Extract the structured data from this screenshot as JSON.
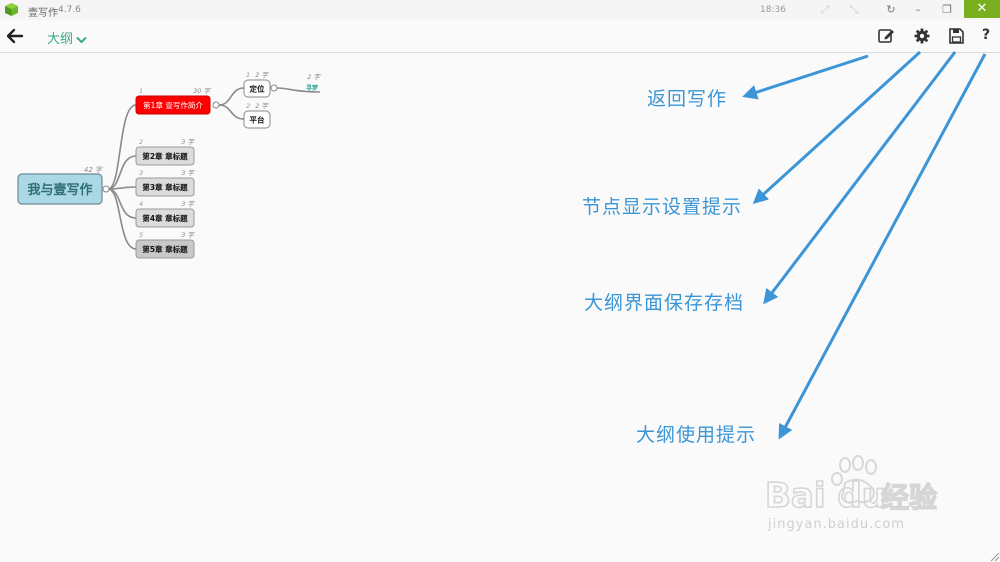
{
  "window": {
    "app_title": "壹写作",
    "version": "4.7.6",
    "clock": "18:36",
    "accent_color": "#7ab01f"
  },
  "toolbar": {
    "view_label": "大纲",
    "tools": [
      "edit-icon",
      "gear-icon",
      "save-icon",
      "help-icon"
    ],
    "help_label": "?"
  },
  "mindmap": {
    "root": {
      "label": "我与壹写作",
      "count": "42 字"
    },
    "chapters": [
      {
        "index": "1",
        "label": "第1章 壹写作简介",
        "count": "30 字",
        "selected": true
      },
      {
        "index": "2",
        "label": "第2章 章标题",
        "count": "3 字"
      },
      {
        "index": "3",
        "label": "第3章 章标题",
        "count": "3 字"
      },
      {
        "index": "4",
        "label": "第4章 章标题",
        "count": "3 字"
      },
      {
        "index": "5",
        "label": "第5章 章标题",
        "count": "3 字"
      }
    ],
    "sub_nodes": [
      {
        "index": "1",
        "label": "定位",
        "count": "2 字"
      },
      {
        "index": "2",
        "label": "平台",
        "count": "2 字"
      }
    ],
    "leaf": {
      "label": "寻梦",
      "count": "2 字"
    },
    "selected_color": "#ff0000",
    "root_color": "#aad8e6"
  },
  "annotations": [
    "返回写作",
    "节点显示设置提示",
    "大纲界面保存存档",
    "大纲使用提示"
  ],
  "watermark": {
    "brand": "Bai du",
    "suffix": "经验",
    "url": "jingyan.baidu.com"
  },
  "annotation_color": "#3b95d6"
}
